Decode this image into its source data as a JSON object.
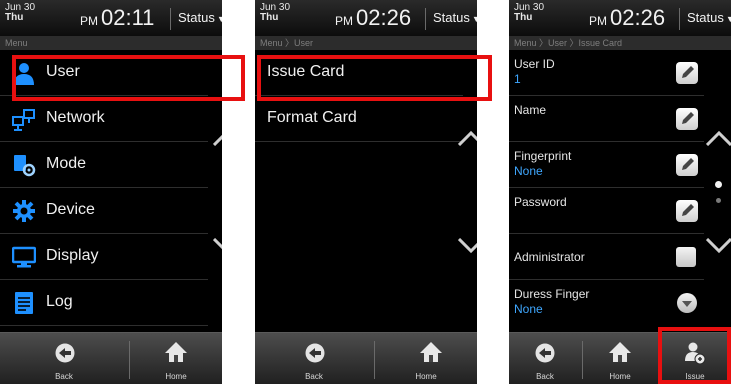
{
  "screens": [
    {
      "date": {
        "day_line": "Jun 30",
        "weekday": "Thu"
      },
      "time": {
        "ampm": "PM",
        "clock": "02:11"
      },
      "status_label": "Status",
      "breadcrumb": "Menu",
      "menu": [
        {
          "label": "User",
          "icon": "user-icon",
          "selected": true
        },
        {
          "label": "Network",
          "icon": "network-icon"
        },
        {
          "label": "Mode",
          "icon": "mode-icon"
        },
        {
          "label": "Device",
          "icon": "gear-icon"
        },
        {
          "label": "Display",
          "icon": "monitor-icon"
        },
        {
          "label": "Log",
          "icon": "log-icon"
        }
      ],
      "bottom": {
        "back": "Back",
        "home": "Home"
      }
    },
    {
      "date": {
        "day_line": "Jun 30",
        "weekday": "Thu"
      },
      "time": {
        "ampm": "PM",
        "clock": "02:26"
      },
      "status_label": "Status",
      "breadcrumb": "Menu 〉User",
      "items": [
        {
          "label": "Issue Card",
          "selected": true
        },
        {
          "label": "Format Card"
        }
      ],
      "bottom": {
        "back": "Back",
        "home": "Home"
      }
    },
    {
      "date": {
        "day_line": "Jun 30",
        "weekday": "Thu"
      },
      "time": {
        "ampm": "PM",
        "clock": "02:26"
      },
      "status_label": "Status",
      "breadcrumb": "Menu 〉User 〉Issue Card",
      "fields": [
        {
          "label": "User ID",
          "value": "1",
          "control": "edit"
        },
        {
          "label": "Name",
          "value": "",
          "control": "edit"
        },
        {
          "label": "Fingerprint",
          "value": "None",
          "control": "edit"
        },
        {
          "label": "Password",
          "value": "",
          "control": "edit"
        },
        {
          "label": "Administrator",
          "value": "",
          "control": "checkbox"
        },
        {
          "label": "Duress Finger",
          "value": "None",
          "control": "dropdown"
        }
      ],
      "bottom": {
        "back": "Back",
        "home": "Home",
        "issue": "Issue"
      }
    }
  ],
  "colors": {
    "highlight": "#e81010",
    "value_blue": "#3fa7ff",
    "icon_blue": "#1e90ff"
  }
}
